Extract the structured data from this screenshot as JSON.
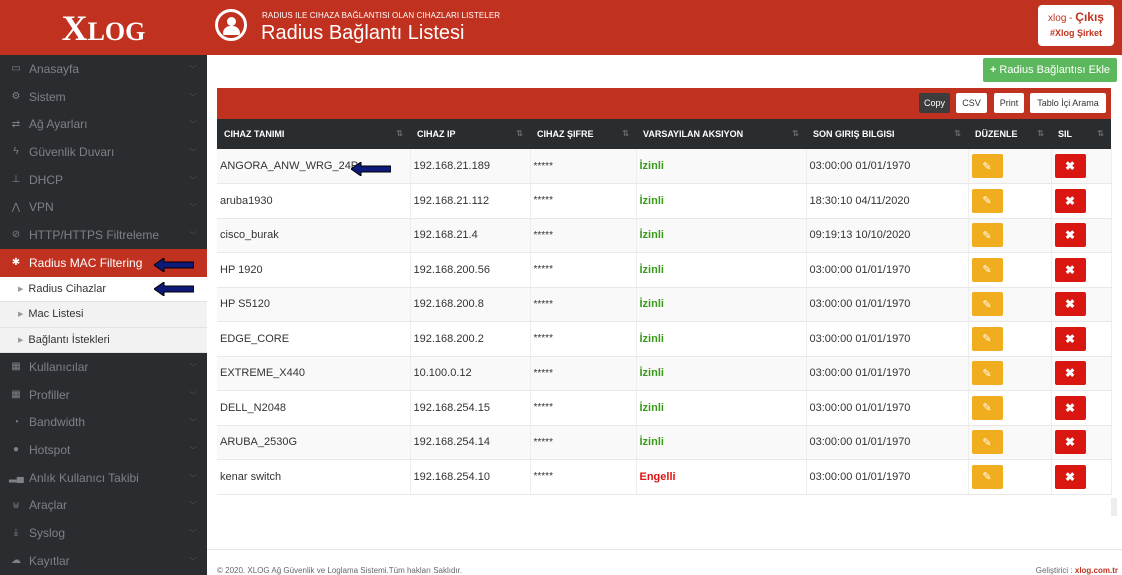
{
  "logo": {
    "first": "X",
    "rest": "LOG"
  },
  "header": {
    "subtitle": "RADIUS ILE CIHAZA BAĞLANTISI OLAN CIHAZLARI LISTELER",
    "title": "Radius Bağlantı Listesi",
    "user": "xlog",
    "separator": " - ",
    "logout": "Çıkış",
    "company": "#Xlog Şirket"
  },
  "sidebar": {
    "items": [
      {
        "label": "Anasayfa",
        "icon": "monitor-icon"
      },
      {
        "label": "Sistem",
        "icon": "cogs-icon"
      },
      {
        "label": "Ağ Ayarları",
        "icon": "shuffle-icon"
      },
      {
        "label": "Güvenlik Duvarı",
        "icon": "bolt-icon"
      },
      {
        "label": "DHCP",
        "icon": "sitemap-icon"
      },
      {
        "label": "VPN",
        "icon": "vpn-icon"
      },
      {
        "label": "HTTP/HTTPS Filtreleme",
        "icon": "eye-slash-icon"
      },
      {
        "label": "Radius MAC Filtering",
        "icon": "asterisk-icon"
      }
    ],
    "subitems": [
      {
        "label": "Radius Cihazlar"
      },
      {
        "label": "Mac Listesi"
      },
      {
        "label": "Bağlantı İstekleri"
      }
    ],
    "items_after": [
      {
        "label": "Kullanıcılar",
        "icon": "grid-icon"
      },
      {
        "label": "Profiller",
        "icon": "grid-icon"
      },
      {
        "label": "Bandwidth",
        "icon": "dashboard-icon"
      },
      {
        "label": "Hotspot",
        "icon": "globe-icon"
      },
      {
        "label": "Anlık Kullanıcı Takibi",
        "icon": "signal-icon"
      },
      {
        "label": "Araçlar",
        "icon": "plug-icon"
      },
      {
        "label": "Syslog",
        "icon": "download-icon"
      },
      {
        "label": "Kayıtlar",
        "icon": "cloud-icon"
      }
    ]
  },
  "toolbar": {
    "add_label": "Radius Bağlantısı Ekle",
    "copy": "Copy",
    "csv": "CSV",
    "print": "Print",
    "search": "Tablo İçi Arama"
  },
  "table": {
    "headers": [
      "CIHAZ TANIMI",
      "CIHAZ IP",
      "CIHAZ ŞIFRE",
      "VARSAYILAN AKSIYON",
      "SON GIRIŞ BILGISI",
      "DÜZENLE",
      "SIL"
    ],
    "rows": [
      {
        "name": "ANGORA_ANW_WRG_24P",
        "ip": "192.168.21.189",
        "pw": "*****",
        "action": "İzinli",
        "status": "ok",
        "last": "03:00:00 01/01/1970"
      },
      {
        "name": "aruba1930",
        "ip": "192.168.21.112",
        "pw": "*****",
        "action": "İzinli",
        "status": "ok",
        "last": "18:30:10 04/11/2020"
      },
      {
        "name": "cisco_burak",
        "ip": "192.168.21.4",
        "pw": "*****",
        "action": "İzinli",
        "status": "ok",
        "last": "09:19:13 10/10/2020"
      },
      {
        "name": "HP 1920",
        "ip": "192.168.200.56",
        "pw": "*****",
        "action": "İzinli",
        "status": "ok",
        "last": "03:00:00 01/01/1970"
      },
      {
        "name": "HP S5120",
        "ip": "192.168.200.8",
        "pw": "*****",
        "action": "İzinli",
        "status": "ok",
        "last": "03:00:00 01/01/1970"
      },
      {
        "name": "EDGE_CORE",
        "ip": "192.168.200.2",
        "pw": "*****",
        "action": "İzinli",
        "status": "ok",
        "last": "03:00:00 01/01/1970"
      },
      {
        "name": "EXTREME_X440",
        "ip": "10.100.0.12",
        "pw": "*****",
        "action": "İzinli",
        "status": "ok",
        "last": "03:00:00 01/01/1970"
      },
      {
        "name": "DELL_N2048",
        "ip": "192.168.254.15",
        "pw": "*****",
        "action": "İzinli",
        "status": "ok",
        "last": "03:00:00 01/01/1970"
      },
      {
        "name": "ARUBA_2530G",
        "ip": "192.168.254.14",
        "pw": "*****",
        "action": "İzinli",
        "status": "ok",
        "last": "03:00:00 01/01/1970"
      },
      {
        "name": "kenar switch",
        "ip": "192.168.254.10",
        "pw": "*****",
        "action": "Engelli",
        "status": "bad",
        "last": "03:00:00 01/01/1970"
      }
    ]
  },
  "footer": {
    "copyright": "© 2020. XLOG Ağ Güvenlik ve Loglama Sistemi.Tüm hakları Saklıdır.",
    "dev_label": "Geliştirici : ",
    "dev_link": "xlog.com.tr"
  },
  "colors": {
    "brand": "#c0311f",
    "sidebar": "#2a2d30",
    "add": "#5cb85c",
    "edit": "#f0ad1e",
    "delete": "#d9160f",
    "allowed": "#3a9a1a",
    "blocked": "#e01414",
    "arrow": "#0d1a7a"
  }
}
